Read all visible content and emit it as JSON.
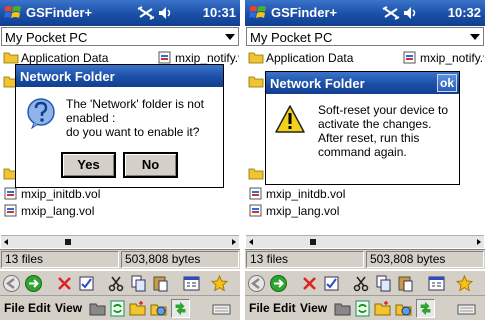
{
  "screens": [
    {
      "titlebar": {
        "app_title": "GSFinder+",
        "clock": "10:31"
      },
      "location": {
        "value": "My Pocket PC"
      },
      "files": {
        "top_left": "Application Data",
        "top_right": "mxip_notify.vol",
        "bottom": [
          "mxip_initdb.vol",
          "mxip_lang.vol"
        ]
      },
      "status": {
        "file_count": "13 files",
        "size": "503,808 bytes"
      },
      "menu": {
        "file": "File",
        "edit": "Edit",
        "view": "View"
      },
      "dialog": {
        "title": "Network Folder",
        "message_line1": "The 'Network' folder is not",
        "message_line2": "enabled :",
        "message_line3": "do you want to enable it?",
        "yes_label": "Yes",
        "no_label": "No",
        "icon": "question-icon"
      }
    },
    {
      "titlebar": {
        "app_title": "GSFinder+",
        "clock": "10:32"
      },
      "location": {
        "value": "My Pocket PC"
      },
      "files": {
        "top_left": "Application Data",
        "top_right": "mxip_notify.vol",
        "bottom": [
          "mxip_initdb.vol",
          "mxip_lang.vol"
        ]
      },
      "status": {
        "file_count": "13 files",
        "size": "503,808 bytes"
      },
      "menu": {
        "file": "File",
        "edit": "Edit",
        "view": "View"
      },
      "dialog": {
        "title": "Network Folder",
        "ok_label": "ok",
        "message_line1": "Soft-reset your device to",
        "message_line2": "activate the changes.",
        "message_line3": "After reset, run this",
        "message_line4": "command again.",
        "icon": "warning-icon"
      }
    }
  ],
  "colors": {
    "titlebar": "#1a4fa8",
    "chrome": "#d4d0c8",
    "folder": "#f2c530"
  }
}
